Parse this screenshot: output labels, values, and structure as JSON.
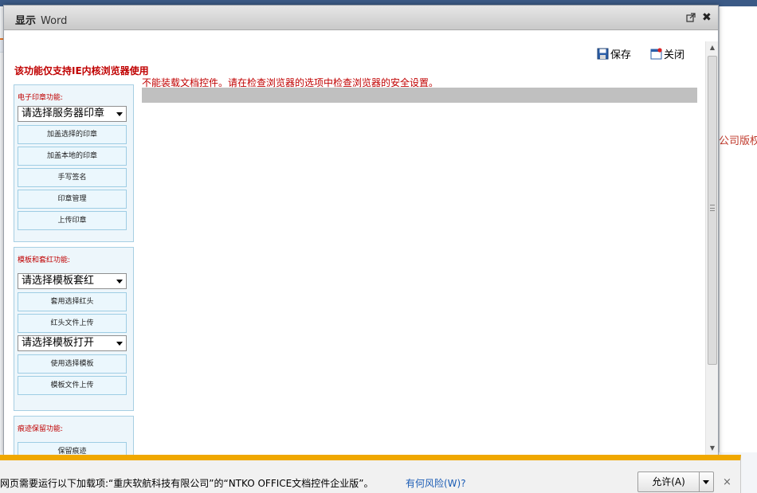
{
  "dialog": {
    "title": "显示",
    "title_sub": "Word",
    "close_glyph": "✖"
  },
  "toolbar": {
    "save_label": "保存",
    "close_label": "关闭"
  },
  "warning": "该功能仅支持IE内核浏览器使用",
  "doc_error": "不能装载文档控件。请在检查浏览器的选项中检查浏览器的安全设置。",
  "seal_panel": {
    "title": "电子印章功能:",
    "select_value": "请选择服务器印章",
    "buttons": [
      "加盖选择的印章",
      "加盖本地的印章",
      "手写签名",
      "印章管理",
      "上传印章"
    ]
  },
  "template_panel": {
    "title": "模板和套红功能:",
    "select_redhead": "请选择模板套红",
    "buttons_redhead": [
      "套用选择红头",
      "红头文件上传"
    ],
    "select_open": "请选择模板打开",
    "buttons_open": [
      "使用选择模板",
      "模板文件上传"
    ]
  },
  "trace_panel": {
    "title": "痕迹保留功能:",
    "buttons": [
      "保留痕迹"
    ]
  },
  "background": {
    "copyright_fragment": "公司版权所"
  },
  "notification": {
    "text": "网页需要运行以下加载项:“重庆软航科技有限公司”的“NTKO OFFICE文档控件企业版”。",
    "risk_link": "有何风险(W)?",
    "allow_label": "允许(A)",
    "close_glyph": "×"
  },
  "colors": {
    "warning_red": "#c00000",
    "notify_accent": "#f0a800",
    "link_blue": "#1a5cb5",
    "panel_bg": "#edf6fb"
  }
}
